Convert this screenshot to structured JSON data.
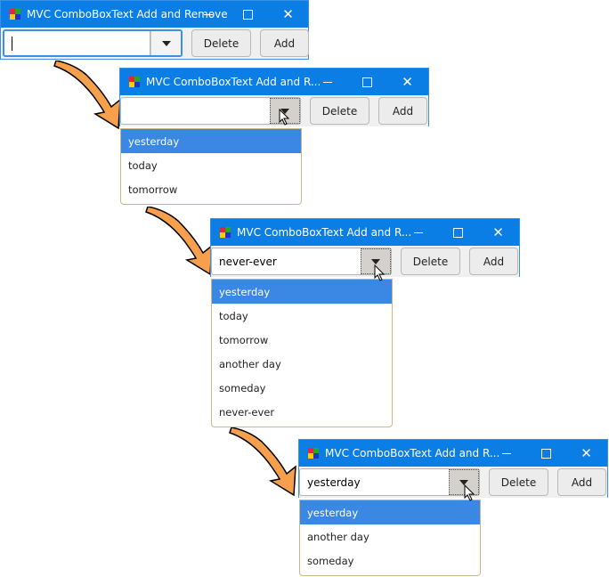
{
  "windows": [
    {
      "title": "MVC ComboBoxText Add and Remove",
      "combo_value": "",
      "delete_label": "Delete",
      "add_label": "Add"
    },
    {
      "title": "MVC ComboBoxText Add and R...",
      "combo_value": "",
      "delete_label": "Delete",
      "add_label": "Add",
      "dropdown": [
        "yesterday",
        "today",
        "tomorrow"
      ]
    },
    {
      "title": "MVC ComboBoxText Add and R...",
      "combo_value": "never-ever",
      "delete_label": "Delete",
      "add_label": "Add",
      "dropdown": [
        "yesterday",
        "today",
        "tomorrow",
        "another day",
        "someday",
        "never-ever"
      ]
    },
    {
      "title": "MVC ComboBoxText Add and R...",
      "combo_value": "yesterday",
      "delete_label": "Delete",
      "add_label": "Add",
      "dropdown": [
        "yesterday",
        "another day",
        "someday"
      ]
    }
  ],
  "icons": {
    "app": "app-cube-icon",
    "minimize": "minimize-icon",
    "maximize": "maximize-icon",
    "close": "close-icon",
    "dropdown": "chevron-down-icon",
    "step_arrow": "orange-arrow-icon",
    "cursor": "mouse-cursor-icon"
  },
  "colors": {
    "titlebar": "#0b7ee6",
    "selection": "#3a87e4",
    "arrow": "#f6a04d"
  }
}
